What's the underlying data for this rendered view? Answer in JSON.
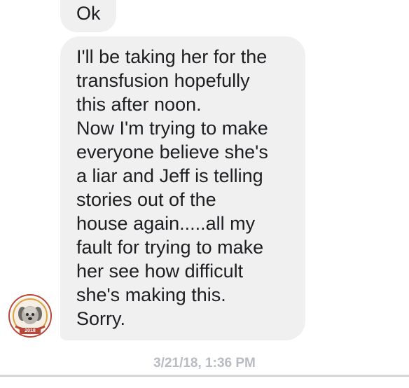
{
  "messages": [
    {
      "id": "msg-ok",
      "lines": [
        "Ok"
      ]
    },
    {
      "id": "msg-long",
      "lines": [
        "I'll be taking her for the",
        "transfusion hopefully",
        "this after noon.",
        "Now I'm trying to make",
        "everyone believe she's",
        "a liar and Jeff is telling",
        "stories out of the",
        "house again.....all my",
        "fault for trying to make",
        "her see how difficult",
        "she's making this.",
        "Sorry."
      ]
    }
  ],
  "avatar": {
    "badge_year": "2018",
    "icon": "dog-avatar-icon"
  },
  "timestamp": "3/21/18, 1:36 PM",
  "colors": {
    "bubble_bg": "#f1f0f0",
    "text": "#1c1e21",
    "timestamp": "#b7bbc2",
    "avatar_ring": "#b9473a"
  }
}
